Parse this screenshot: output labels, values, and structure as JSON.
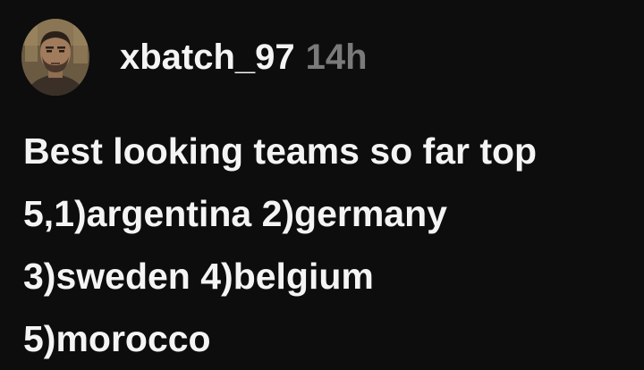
{
  "comment": {
    "author": {
      "username": "xbatch_97",
      "avatar_icon": "user-avatar-photo"
    },
    "timestamp": "14h",
    "text_lines": [
      "Best looking teams so far top",
      "5,1)argentina 2)germany",
      "3)sweden 4)belgium",
      "5)morocco"
    ]
  },
  "colors": {
    "background": "#0d0d0d",
    "text": "#f4f4f4",
    "timestamp": "#7a7a7a"
  }
}
